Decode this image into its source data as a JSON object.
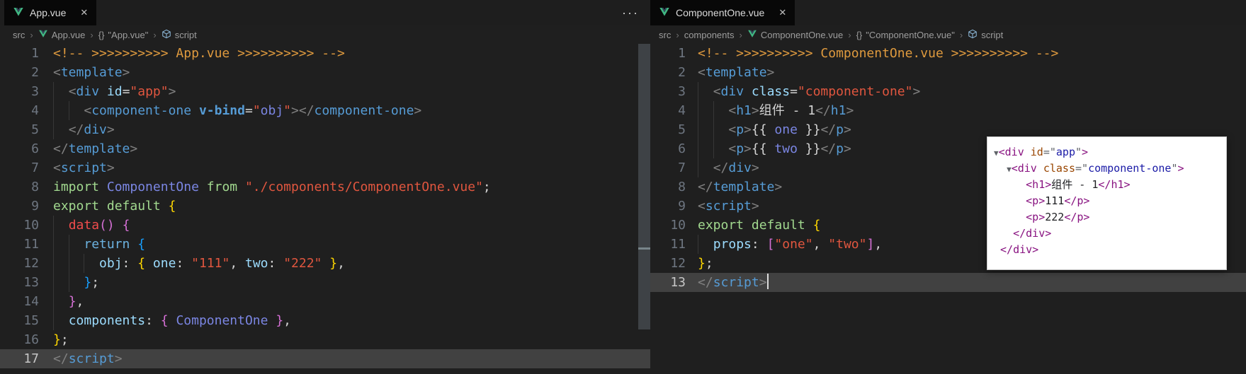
{
  "colors": {
    "bg": "#1f1f1f",
    "tabbar_bg": "#1e1e1e",
    "tab_active_bg": "#080808",
    "tab_text": "#dadada",
    "breadcrumb_text": "#9d9d9d",
    "line_number": "#6e7681",
    "line_number_active": "#c6c6c6",
    "current_line": "#414141",
    "guide": "#373737",
    "scrollbar": "#3e4246",
    "comment": "#df9a3e",
    "tag_bracket": "#808080",
    "tag": "#569cd6",
    "attr_name": "#9cdcfe",
    "string": "#e0563f",
    "keyword": "#a2d98f",
    "keyword_return": "#6cb2e0",
    "method_red": "#f14c4c",
    "purple_ident": "#7b86e3",
    "property": "#9cdcfe",
    "punctuation": "#d4d4d4",
    "bracket1": "#ffd700",
    "bracket2": "#d670d6",
    "bracket3": "#179fff",
    "plain_text": "#d4d4d4",
    "vbind": "#569cd6",
    "cursor": "#dcdcdc",
    "vue_green": "#41b883",
    "vue_dark": "#35495e",
    "dt_bg": "#ffffff",
    "dt_tag": "#881280",
    "dt_attr": "#994500",
    "dt_value": "#1a1aa6",
    "dt_pun": "#5f6368",
    "dt_text": "#202124"
  },
  "icons": {
    "close": "✕",
    "more": "···",
    "braces": "{}"
  },
  "left": {
    "tab": {
      "label": "App.vue"
    },
    "breadcrumbs": [
      {
        "label": "src"
      },
      {
        "icon": "vue",
        "label": "App.vue"
      },
      {
        "icon": "braces",
        "label": "\"App.vue\""
      },
      {
        "icon": "module",
        "label": "script"
      }
    ],
    "active_line": 17,
    "cursor_line": null,
    "lines": [
      [
        [
          "cm",
          "<!-- >>>>>>>>>> App.vue >>>>>>>>>> -->"
        ]
      ],
      [
        [
          "tagb",
          "<"
        ],
        [
          "tag",
          "template"
        ],
        [
          "tagb",
          ">"
        ]
      ],
      [
        [
          "txt",
          "  "
        ],
        [
          "tagb",
          "<"
        ],
        [
          "tag",
          "div"
        ],
        [
          "txt",
          " "
        ],
        [
          "attr",
          "id"
        ],
        [
          "pun",
          "="
        ],
        [
          "str",
          "\"app\""
        ],
        [
          "tagb",
          ">"
        ]
      ],
      [
        [
          "txt",
          "    "
        ],
        [
          "tagb",
          "<"
        ],
        [
          "tag",
          "component-one"
        ],
        [
          "txt",
          " "
        ],
        [
          "vbind",
          "v-bind"
        ],
        [
          "pun",
          "="
        ],
        [
          "str",
          "\""
        ],
        [
          "purp",
          "obj"
        ],
        [
          "str",
          "\""
        ],
        [
          "tagb",
          "></"
        ],
        [
          "tag",
          "component-one"
        ],
        [
          "tagb",
          ">"
        ]
      ],
      [
        [
          "txt",
          "  "
        ],
        [
          "tagb",
          "</"
        ],
        [
          "tag",
          "div"
        ],
        [
          "tagb",
          ">"
        ]
      ],
      [
        [
          "tagb",
          "</"
        ],
        [
          "tag",
          "template"
        ],
        [
          "tagb",
          ">"
        ]
      ],
      [
        [
          "tagb",
          "<"
        ],
        [
          "tag",
          "script"
        ],
        [
          "tagb",
          ">"
        ]
      ],
      [
        [
          "kw",
          "import"
        ],
        [
          "txt",
          " "
        ],
        [
          "purp",
          "ComponentOne"
        ],
        [
          "txt",
          " "
        ],
        [
          "kw",
          "from"
        ],
        [
          "txt",
          " "
        ],
        [
          "str",
          "\"./components/ComponentOne.vue\""
        ],
        [
          "pun",
          ";"
        ]
      ],
      [
        [
          "kw",
          "export"
        ],
        [
          "txt",
          " "
        ],
        [
          "kw",
          "default"
        ],
        [
          "txt",
          " "
        ],
        [
          "b1",
          "{"
        ]
      ],
      [
        [
          "txt",
          "  "
        ],
        [
          "red",
          "data"
        ],
        [
          "b2",
          "()"
        ],
        [
          "txt",
          " "
        ],
        [
          "b2",
          "{"
        ]
      ],
      [
        [
          "txt",
          "    "
        ],
        [
          "ret",
          "return"
        ],
        [
          "txt",
          " "
        ],
        [
          "b3",
          "{"
        ]
      ],
      [
        [
          "txt",
          "      "
        ],
        [
          "prop",
          "obj"
        ],
        [
          "pun",
          ":"
        ],
        [
          "txt",
          " "
        ],
        [
          "b1",
          "{"
        ],
        [
          "txt",
          " "
        ],
        [
          "prop",
          "one"
        ],
        [
          "pun",
          ":"
        ],
        [
          "txt",
          " "
        ],
        [
          "str",
          "\"111\""
        ],
        [
          "pun",
          ","
        ],
        [
          "txt",
          " "
        ],
        [
          "prop",
          "two"
        ],
        [
          "pun",
          ":"
        ],
        [
          "txt",
          " "
        ],
        [
          "str",
          "\"222\""
        ],
        [
          "txt",
          " "
        ],
        [
          "b1",
          "}"
        ],
        [
          "pun",
          ","
        ]
      ],
      [
        [
          "txt",
          "    "
        ],
        [
          "b3",
          "}"
        ],
        [
          "pun",
          ";"
        ]
      ],
      [
        [
          "txt",
          "  "
        ],
        [
          "b2",
          "}"
        ],
        [
          "pun",
          ","
        ]
      ],
      [
        [
          "txt",
          "  "
        ],
        [
          "prop",
          "components"
        ],
        [
          "pun",
          ":"
        ],
        [
          "txt",
          " "
        ],
        [
          "b2",
          "{"
        ],
        [
          "txt",
          " "
        ],
        [
          "purp",
          "ComponentOne"
        ],
        [
          "txt",
          " "
        ],
        [
          "b2",
          "}"
        ],
        [
          "pun",
          ","
        ]
      ],
      [
        [
          "b1",
          "}"
        ],
        [
          "pun",
          ";"
        ]
      ],
      [
        [
          "tagb",
          "</"
        ],
        [
          "tag",
          "script"
        ],
        [
          "tagb",
          ">"
        ]
      ]
    ]
  },
  "right": {
    "tab": {
      "label": "ComponentOne.vue"
    },
    "breadcrumbs": [
      {
        "label": "src"
      },
      {
        "label": "components"
      },
      {
        "icon": "vue",
        "label": "ComponentOne.vue"
      },
      {
        "icon": "braces",
        "label": "\"ComponentOne.vue\""
      },
      {
        "icon": "module",
        "label": "script"
      }
    ],
    "active_line": 13,
    "cursor_line": 13,
    "lines": [
      [
        [
          "cm",
          "<!-- >>>>>>>>>> ComponentOne.vue >>>>>>>>>> -->"
        ]
      ],
      [
        [
          "tagb",
          "<"
        ],
        [
          "tag",
          "template"
        ],
        [
          "tagb",
          ">"
        ]
      ],
      [
        [
          "txt",
          "  "
        ],
        [
          "tagb",
          "<"
        ],
        [
          "tag",
          "div"
        ],
        [
          "txt",
          " "
        ],
        [
          "attr",
          "class"
        ],
        [
          "pun",
          "="
        ],
        [
          "str",
          "\"component-one\""
        ],
        [
          "tagb",
          ">"
        ]
      ],
      [
        [
          "txt",
          "    "
        ],
        [
          "tagb",
          "<"
        ],
        [
          "tag",
          "h1"
        ],
        [
          "tagb",
          ">"
        ],
        [
          "txt",
          "组件 - 1"
        ],
        [
          "tagb",
          "</"
        ],
        [
          "tag",
          "h1"
        ],
        [
          "tagb",
          ">"
        ]
      ],
      [
        [
          "txt",
          "    "
        ],
        [
          "tagb",
          "<"
        ],
        [
          "tag",
          "p"
        ],
        [
          "tagb",
          ">"
        ],
        [
          "txt",
          "{{ "
        ],
        [
          "purp",
          "one"
        ],
        [
          "txt",
          " }}"
        ],
        [
          "tagb",
          "</"
        ],
        [
          "tag",
          "p"
        ],
        [
          "tagb",
          ">"
        ]
      ],
      [
        [
          "txt",
          "    "
        ],
        [
          "tagb",
          "<"
        ],
        [
          "tag",
          "p"
        ],
        [
          "tagb",
          ">"
        ],
        [
          "txt",
          "{{ "
        ],
        [
          "purp",
          "two"
        ],
        [
          "txt",
          " }}"
        ],
        [
          "tagb",
          "</"
        ],
        [
          "tag",
          "p"
        ],
        [
          "tagb",
          ">"
        ]
      ],
      [
        [
          "txt",
          "  "
        ],
        [
          "tagb",
          "</"
        ],
        [
          "tag",
          "div"
        ],
        [
          "tagb",
          ">"
        ]
      ],
      [
        [
          "tagb",
          "</"
        ],
        [
          "tag",
          "template"
        ],
        [
          "tagb",
          ">"
        ]
      ],
      [
        [
          "tagb",
          "<"
        ],
        [
          "tag",
          "script"
        ],
        [
          "tagb",
          ">"
        ]
      ],
      [
        [
          "kw",
          "export"
        ],
        [
          "txt",
          " "
        ],
        [
          "kw",
          "default"
        ],
        [
          "txt",
          " "
        ],
        [
          "b1",
          "{"
        ]
      ],
      [
        [
          "txt",
          "  "
        ],
        [
          "prop",
          "props"
        ],
        [
          "pun",
          ":"
        ],
        [
          "txt",
          " "
        ],
        [
          "b2",
          "["
        ],
        [
          "str",
          "\"one\""
        ],
        [
          "pun",
          ","
        ],
        [
          "txt",
          " "
        ],
        [
          "str",
          "\"two\""
        ],
        [
          "b2",
          "]"
        ],
        [
          "pun",
          ","
        ]
      ],
      [
        [
          "b1",
          "}"
        ],
        [
          "pun",
          ";"
        ]
      ],
      [
        [
          "tagb",
          "</"
        ],
        [
          "tag",
          "script"
        ],
        [
          "tagb",
          ">"
        ]
      ]
    ]
  },
  "devtools": {
    "lines": [
      [
        [
          "darr",
          "▼"
        ],
        [
          "dtag",
          "<div"
        ],
        [
          "dtxt",
          " "
        ],
        [
          "dattr",
          "id"
        ],
        [
          "dpun",
          "=\""
        ],
        [
          "dval",
          "app"
        ],
        [
          "dpun",
          "\""
        ],
        [
          "dtag",
          ">"
        ]
      ],
      [
        [
          "dtxt",
          "  "
        ],
        [
          "darr",
          "▼"
        ],
        [
          "dtag",
          "<div"
        ],
        [
          "dtxt",
          " "
        ],
        [
          "dattr",
          "class"
        ],
        [
          "dpun",
          "=\""
        ],
        [
          "dval",
          "component-one"
        ],
        [
          "dpun",
          "\""
        ],
        [
          "dtag",
          ">"
        ]
      ],
      [
        [
          "dtxt",
          "     "
        ],
        [
          "dtag",
          "<h1>"
        ],
        [
          "dtxt",
          "组件 - 1"
        ],
        [
          "dtag",
          "</h1>"
        ]
      ],
      [
        [
          "dtxt",
          "     "
        ],
        [
          "dtag",
          "<p>"
        ],
        [
          "dtxt",
          "111"
        ],
        [
          "dtag",
          "</p>"
        ]
      ],
      [
        [
          "dtxt",
          "     "
        ],
        [
          "dtag",
          "<p>"
        ],
        [
          "dtxt",
          "222"
        ],
        [
          "dtag",
          "</p>"
        ]
      ],
      [
        [
          "dtxt",
          "   "
        ],
        [
          "dtag",
          "</div>"
        ]
      ],
      [
        [
          "dtxt",
          " "
        ],
        [
          "dtag",
          "</div>"
        ]
      ]
    ]
  }
}
